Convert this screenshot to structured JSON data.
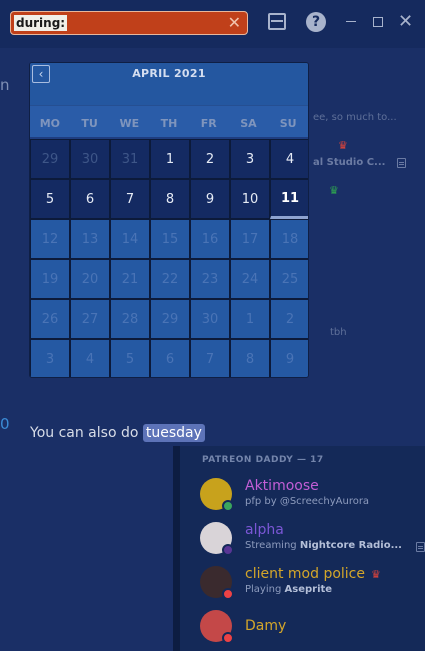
{
  "search": {
    "filter_token": "during:",
    "clear_glyph": "✕"
  },
  "titlebar": {
    "help_glyph": "?",
    "close_glyph": "✕"
  },
  "background": {
    "left_fragment": "n",
    "right_fragments": [
      "ee, so much to...",
      "al Studio C...",
      "tbh"
    ],
    "cyan_fragment": "0"
  },
  "calendar": {
    "month_label": "APRIL 2021",
    "prev_glyph": "‹",
    "weekdays": [
      "MO",
      "TU",
      "WE",
      "TH",
      "FR",
      "SA",
      "SU"
    ],
    "today": 11,
    "weeks": [
      [
        {
          "d": "29",
          "m": true
        },
        {
          "d": "30",
          "m": true
        },
        {
          "d": "31",
          "m": true
        },
        {
          "d": "1"
        },
        {
          "d": "2"
        },
        {
          "d": "3"
        },
        {
          "d": "4"
        }
      ],
      [
        {
          "d": "5"
        },
        {
          "d": "6"
        },
        {
          "d": "7"
        },
        {
          "d": "8"
        },
        {
          "d": "9"
        },
        {
          "d": "10"
        },
        {
          "d": "11",
          "t": true
        }
      ],
      [
        {
          "d": "12",
          "f": true
        },
        {
          "d": "13",
          "f": true
        },
        {
          "d": "14",
          "f": true
        },
        {
          "d": "15",
          "f": true
        },
        {
          "d": "16",
          "f": true
        },
        {
          "d": "17",
          "f": true
        },
        {
          "d": "18",
          "f": true
        }
      ],
      [
        {
          "d": "19",
          "f": true
        },
        {
          "d": "20",
          "f": true
        },
        {
          "d": "21",
          "f": true
        },
        {
          "d": "22",
          "f": true
        },
        {
          "d": "23",
          "f": true
        },
        {
          "d": "24",
          "f": true
        },
        {
          "d": "25",
          "f": true
        }
      ],
      [
        {
          "d": "26",
          "f": true
        },
        {
          "d": "27",
          "f": true
        },
        {
          "d": "28",
          "f": true
        },
        {
          "d": "29",
          "f": true
        },
        {
          "d": "30",
          "f": true
        },
        {
          "d": "1",
          "f": true
        },
        {
          "d": "2",
          "f": true
        }
      ],
      [
        {
          "d": "3",
          "f": true
        },
        {
          "d": "4",
          "f": true
        },
        {
          "d": "5",
          "f": true
        },
        {
          "d": "6",
          "f": true
        },
        {
          "d": "7",
          "f": true
        },
        {
          "d": "8",
          "f": true
        },
        {
          "d": "9",
          "f": true
        }
      ]
    ]
  },
  "hint": {
    "text": "You can also do",
    "highlight": "tuesday"
  },
  "members": {
    "section_title": "PATREON DADDY — 17",
    "list": [
      {
        "name": "Aktimoose",
        "name_color": "#c25ed6",
        "activity_prefix": "pfp by @ScreechyAurora",
        "activity_bold": "",
        "status": "online",
        "avatar_color": "#c8a21c"
      },
      {
        "name": "alpha",
        "name_color": "#7b57d6",
        "activity_prefix": "Streaming ",
        "activity_bold": "Nightcore Radio...",
        "status": "streaming",
        "avatar_color": "#d9d4d8"
      },
      {
        "name": "client mod police",
        "name_color": "#d4a62a",
        "activity_prefix": "Playing ",
        "activity_bold": "Aseprite",
        "status": "dnd",
        "avatar_color": "#3a2a2e"
      },
      {
        "name": "Damy",
        "name_color": "#d4a62a",
        "activity_prefix": "",
        "activity_bold": "",
        "status": "dnd",
        "avatar_color": "#c44848"
      }
    ]
  },
  "colors": {
    "accent": "#c0401a",
    "highlight": "#5d73b8",
    "crown_red": "#e0443a",
    "crown_green": "#2fa84f"
  }
}
